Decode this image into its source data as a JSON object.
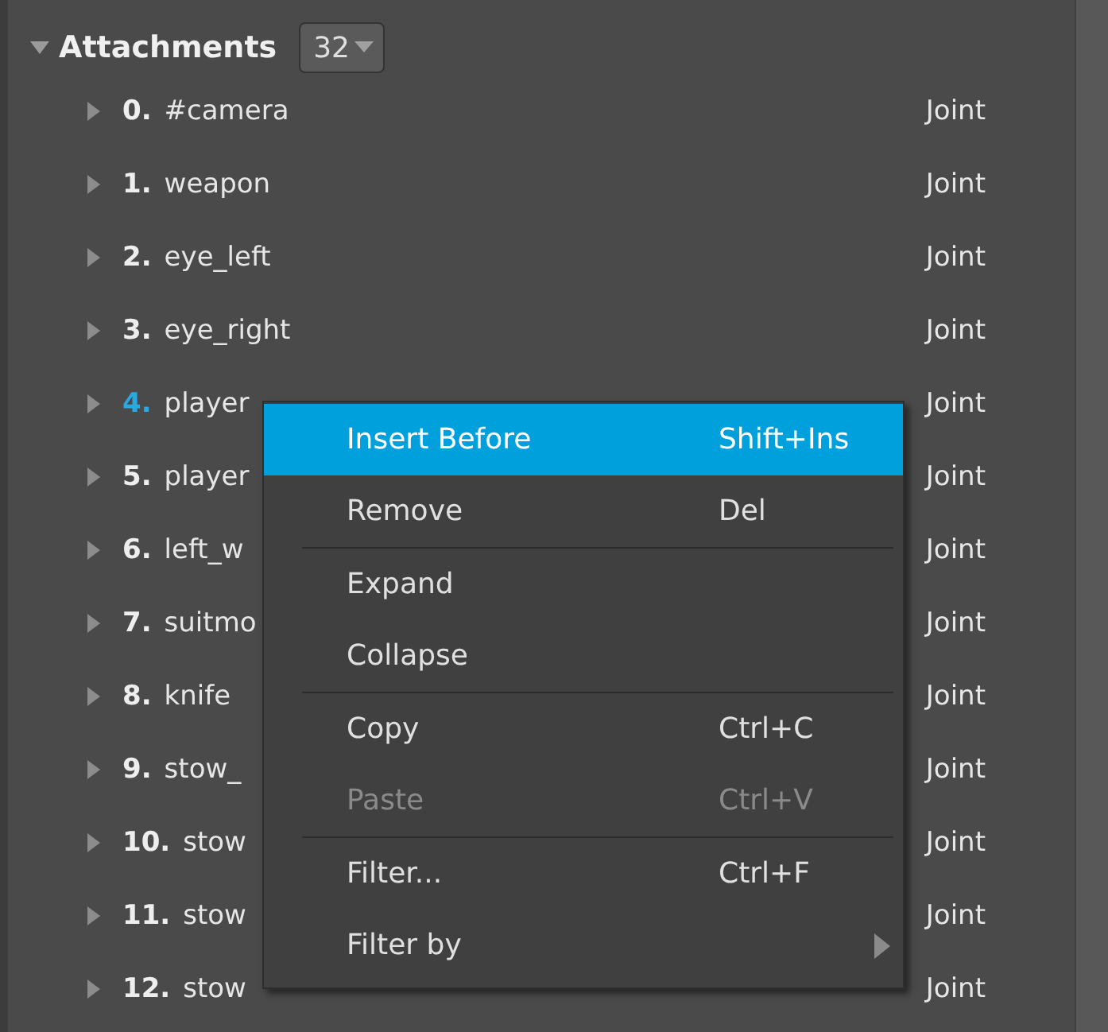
{
  "section": {
    "title": "Attachments",
    "expanded": true,
    "count": "32"
  },
  "rows": [
    {
      "index": "0.",
      "name": "#camera",
      "type": "Joint",
      "selected": false
    },
    {
      "index": "1.",
      "name": "weapon",
      "type": "Joint",
      "selected": false
    },
    {
      "index": "2.",
      "name": "eye_left",
      "type": "Joint",
      "selected": false
    },
    {
      "index": "3.",
      "name": "eye_right",
      "type": "Joint",
      "selected": false
    },
    {
      "index": "4.",
      "name": "player",
      "type": "Joint",
      "selected": true
    },
    {
      "index": "5.",
      "name": "player",
      "type": "Joint",
      "selected": false
    },
    {
      "index": "6.",
      "name": "left_w",
      "type": "Joint",
      "selected": false
    },
    {
      "index": "7.",
      "name": "suitmo",
      "type": "Joint",
      "selected": false
    },
    {
      "index": "8.",
      "name": "knife",
      "type": "Joint",
      "selected": false
    },
    {
      "index": "9.",
      "name": "stow_",
      "type": "Joint",
      "selected": false
    },
    {
      "index": "10.",
      "name": "stow",
      "type": "Joint",
      "selected": false
    },
    {
      "index": "11.",
      "name": "stow",
      "type": "Joint",
      "selected": false
    },
    {
      "index": "12.",
      "name": "stow",
      "type": "Joint",
      "selected": false
    }
  ],
  "context_menu": [
    {
      "kind": "item",
      "label": "Insert Before",
      "shortcut": "Shift+Ins",
      "highlighted": true,
      "disabled": false
    },
    {
      "kind": "item",
      "label": "Remove",
      "shortcut": "Del",
      "highlighted": false,
      "disabled": false
    },
    {
      "kind": "separator"
    },
    {
      "kind": "item",
      "label": "Expand",
      "highlighted": false,
      "disabled": false
    },
    {
      "kind": "item",
      "label": "Collapse",
      "highlighted": false,
      "disabled": false
    },
    {
      "kind": "separator"
    },
    {
      "kind": "item",
      "label": "Copy",
      "shortcut": "Ctrl+C",
      "highlighted": false,
      "disabled": false
    },
    {
      "kind": "item",
      "label": "Paste",
      "shortcut": "Ctrl+V",
      "highlighted": false,
      "disabled": true
    },
    {
      "kind": "separator"
    },
    {
      "kind": "item",
      "label": "Filter...",
      "shortcut": "Ctrl+F",
      "highlighted": false,
      "disabled": false
    },
    {
      "kind": "submenu",
      "label": "Filter by",
      "highlighted": false,
      "disabled": false
    }
  ]
}
